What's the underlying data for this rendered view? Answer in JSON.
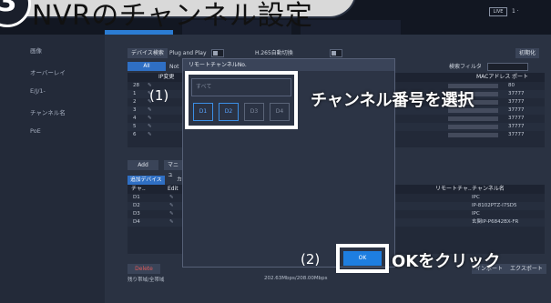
{
  "banner": {
    "step": "3",
    "title": "NVRのチャンネル設定"
  },
  "topbar": {
    "live_label": "LIVE",
    "user_label": "1 ·"
  },
  "sidebar": {
    "items": [
      {
        "label": "画像"
      },
      {
        "label": "オーバーレイ"
      },
      {
        "label": "E/J/1-"
      },
      {
        "label": "チャンネル名"
      },
      {
        "label": "PoE"
      }
    ]
  },
  "toolbar": {
    "device_search": "デバイス検索",
    "plug_and_play": "Plug and Play",
    "h265_auto": "H.265自動切換",
    "initialize": "初期化",
    "all_tab": "All",
    "notice": "Not",
    "search_filter": "検索フィルタ",
    "mac_header": "MACアドレス",
    "port_header": "ポート",
    "ip_change": "IP変更"
  },
  "upper_rows": [
    {
      "num": "28",
      "port": "80"
    },
    {
      "num": "1",
      "port": "37777"
    },
    {
      "num": "2",
      "port": "37777"
    },
    {
      "num": "3",
      "port": "37777"
    },
    {
      "num": "4",
      "port": "37777"
    },
    {
      "num": "5",
      "port": "37777"
    },
    {
      "num": "6",
      "port": "37777"
    }
  ],
  "add_section": {
    "add_label": "Add",
    "manual_label": "マニュ",
    "added_devices_tab": "追加デバイス",
    "camera_tab": "カメ",
    "ch_header": "チャ..",
    "edit_header": "Edit",
    "remote_ch_header": "リモートチャ..",
    "ch_name_header": "チャンネル名"
  },
  "lower_rows": [
    {
      "ch": "D1",
      "name": "IPC"
    },
    {
      "ch": "D2",
      "name": "IP-8102PTZ-I7SD5"
    },
    {
      "ch": "D3",
      "name": "IPC"
    },
    {
      "ch": "D4",
      "name": "玄関IP-P6842BX-FR"
    }
  ],
  "footer": {
    "delete_label": "Delete",
    "remaining_bandwidth": "残り帯域/全帯域",
    "bandwidth_value": "202.63Mbps/208.00Mbps",
    "import_label": "インポート",
    "export_label": "エクスポート"
  },
  "modal": {
    "title": "リモートチャンネルNo.",
    "all_label": "すべて",
    "channels": [
      {
        "label": "D1",
        "selected": true
      },
      {
        "label": "D2",
        "selected": true
      },
      {
        "label": "D3",
        "selected": false
      },
      {
        "label": "D4",
        "selected": false
      }
    ],
    "ok_label": "OK"
  },
  "callouts": {
    "step1": "(1)",
    "step1_text": "チャンネル番号を選択",
    "step2": "(2)",
    "step2_text": "OKをクリック"
  },
  "colors": {
    "accent": "#1e7ee0",
    "highlight": "#ffffff",
    "background": "#2a3242"
  }
}
